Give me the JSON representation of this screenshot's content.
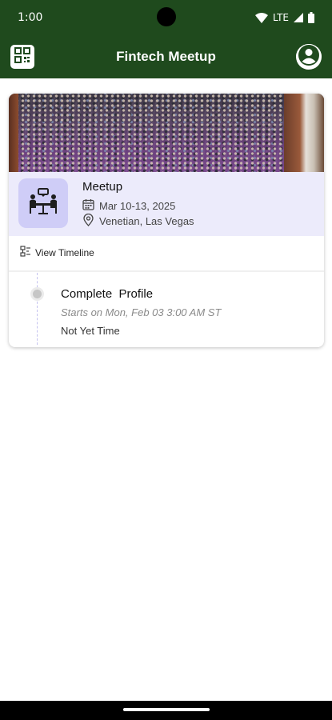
{
  "status_bar": {
    "time": "1:00",
    "network": "LTE",
    "icons": [
      "wifi-icon",
      "signal-icon",
      "battery-icon"
    ]
  },
  "app_bar": {
    "title": "Fintech Meetup",
    "left_icon": "qr-code-icon",
    "right_icon": "account-circle-icon",
    "background_color": "#1f4a1d"
  },
  "event_card": {
    "banner_image": "conference-crowd",
    "event_icon": "meeting-table-icon",
    "name": "Meetup",
    "date": "Mar 10-13, 2025",
    "location": "Venetian, Las Vegas",
    "view_timeline_label": "View Timeline",
    "timeline": [
      {
        "title": "Complete  Profile",
        "starts": "Starts on Mon, Feb 03 3:00 AM ST",
        "status": "Not Yet Time"
      }
    ],
    "info_background": "#ecebfb",
    "icon_box_color": "#cfcdf7"
  }
}
